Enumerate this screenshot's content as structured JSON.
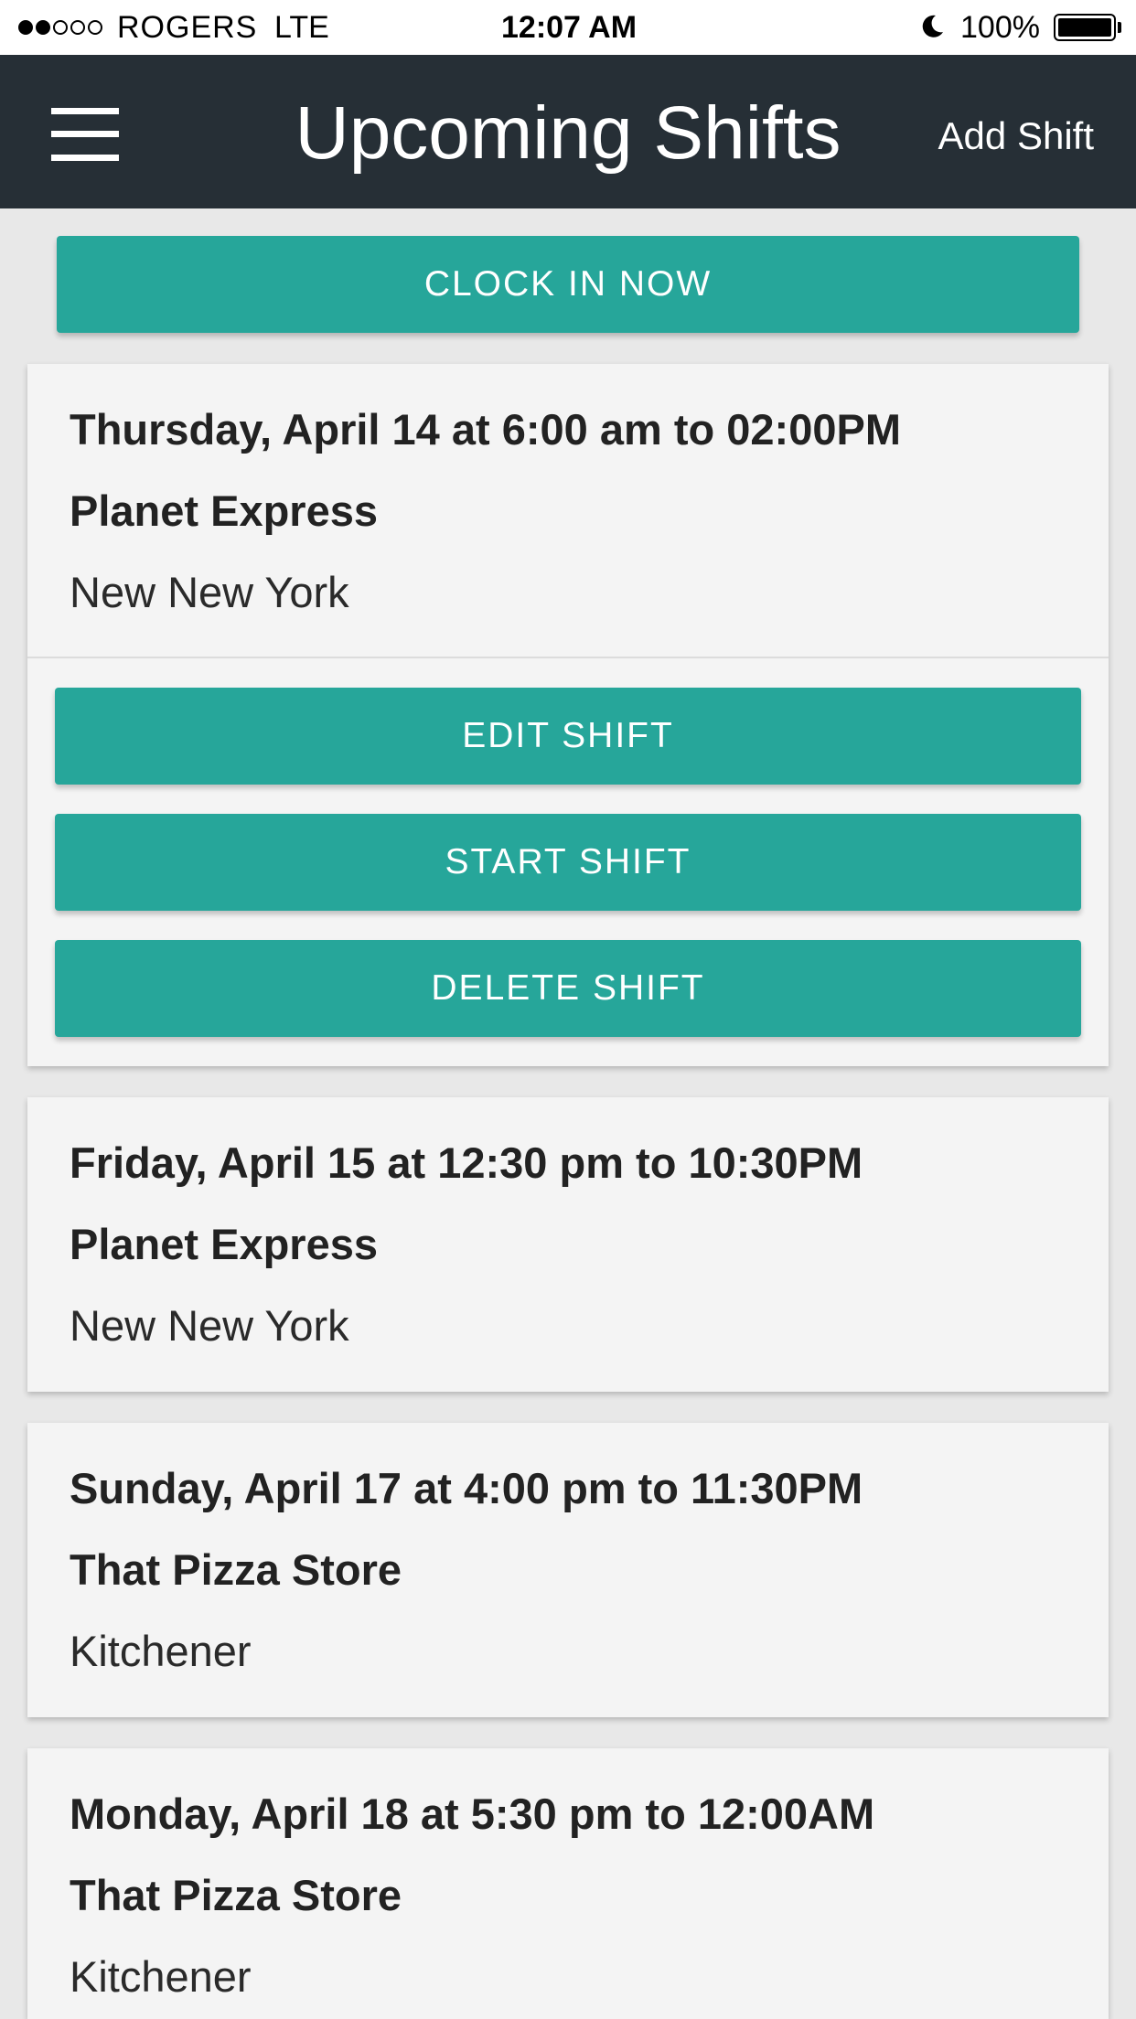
{
  "status_bar": {
    "carrier": "ROGERS",
    "network": "LTE",
    "time": "12:07 AM",
    "battery": "100%",
    "signal_icon": "signal-dots-icon",
    "moon_icon": "moon-icon",
    "battery_icon": "battery-icon"
  },
  "nav": {
    "menu_icon": "hamburger-menu-icon",
    "title": "Upcoming Shifts",
    "add_label": "Add Shift"
  },
  "clock_in_label": "CLOCK IN NOW",
  "colors": {
    "nav_background": "#262f36",
    "accent": "#26a69a",
    "card_background": "#f4f4f4",
    "page_background": "#e8e8e8"
  },
  "shifts": [
    {
      "datetime": "Thursday, April 14 at 6:00 am to 02:00PM",
      "employer": "Planet Express",
      "location": "New New York",
      "actions": {
        "edit": "EDIT SHIFT",
        "start": "START SHIFT",
        "delete": "DELETE SHIFT"
      }
    },
    {
      "datetime": "Friday, April 15 at 12:30 pm to 10:30PM",
      "employer": "Planet Express",
      "location": "New New York"
    },
    {
      "datetime": "Sunday, April 17 at 4:00 pm to 11:30PM",
      "employer": "That Pizza Store",
      "location": "Kitchener"
    },
    {
      "datetime": "Monday, April 18 at 5:30 pm to 12:00AM",
      "employer": "That Pizza Store",
      "location": "Kitchener"
    }
  ]
}
